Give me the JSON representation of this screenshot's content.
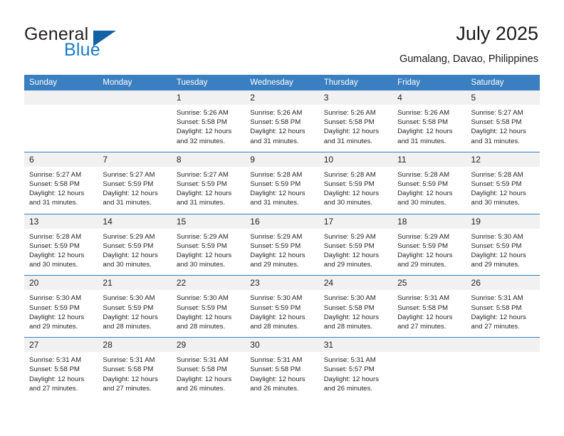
{
  "brand": {
    "name_part1": "General",
    "name_part2": "Blue",
    "triangle_icon": "triangle-icon"
  },
  "header": {
    "title": "July 2025",
    "subtitle": "Gumalang, Davao, Philippines"
  },
  "calendar": {
    "weekday_headers": [
      "Sunday",
      "Monday",
      "Tuesday",
      "Wednesday",
      "Thursday",
      "Friday",
      "Saturday"
    ],
    "accent_color": "#3a7fc1",
    "daynum_bg": "#f1f1f1",
    "weeks": [
      [
        {
          "day": "",
          "lines": []
        },
        {
          "day": "",
          "lines": []
        },
        {
          "day": "1",
          "lines": [
            "Sunrise: 5:26 AM",
            "Sunset: 5:58 PM",
            "Daylight: 12 hours",
            "and 32 minutes."
          ]
        },
        {
          "day": "2",
          "lines": [
            "Sunrise: 5:26 AM",
            "Sunset: 5:58 PM",
            "Daylight: 12 hours",
            "and 31 minutes."
          ]
        },
        {
          "day": "3",
          "lines": [
            "Sunrise: 5:26 AM",
            "Sunset: 5:58 PM",
            "Daylight: 12 hours",
            "and 31 minutes."
          ]
        },
        {
          "day": "4",
          "lines": [
            "Sunrise: 5:26 AM",
            "Sunset: 5:58 PM",
            "Daylight: 12 hours",
            "and 31 minutes."
          ]
        },
        {
          "day": "5",
          "lines": [
            "Sunrise: 5:27 AM",
            "Sunset: 5:58 PM",
            "Daylight: 12 hours",
            "and 31 minutes."
          ]
        }
      ],
      [
        {
          "day": "6",
          "lines": [
            "Sunrise: 5:27 AM",
            "Sunset: 5:58 PM",
            "Daylight: 12 hours",
            "and 31 minutes."
          ]
        },
        {
          "day": "7",
          "lines": [
            "Sunrise: 5:27 AM",
            "Sunset: 5:59 PM",
            "Daylight: 12 hours",
            "and 31 minutes."
          ]
        },
        {
          "day": "8",
          "lines": [
            "Sunrise: 5:27 AM",
            "Sunset: 5:59 PM",
            "Daylight: 12 hours",
            "and 31 minutes."
          ]
        },
        {
          "day": "9",
          "lines": [
            "Sunrise: 5:28 AM",
            "Sunset: 5:59 PM",
            "Daylight: 12 hours",
            "and 31 minutes."
          ]
        },
        {
          "day": "10",
          "lines": [
            "Sunrise: 5:28 AM",
            "Sunset: 5:59 PM",
            "Daylight: 12 hours",
            "and 30 minutes."
          ]
        },
        {
          "day": "11",
          "lines": [
            "Sunrise: 5:28 AM",
            "Sunset: 5:59 PM",
            "Daylight: 12 hours",
            "and 30 minutes."
          ]
        },
        {
          "day": "12",
          "lines": [
            "Sunrise: 5:28 AM",
            "Sunset: 5:59 PM",
            "Daylight: 12 hours",
            "and 30 minutes."
          ]
        }
      ],
      [
        {
          "day": "13",
          "lines": [
            "Sunrise: 5:28 AM",
            "Sunset: 5:59 PM",
            "Daylight: 12 hours",
            "and 30 minutes."
          ]
        },
        {
          "day": "14",
          "lines": [
            "Sunrise: 5:29 AM",
            "Sunset: 5:59 PM",
            "Daylight: 12 hours",
            "and 30 minutes."
          ]
        },
        {
          "day": "15",
          "lines": [
            "Sunrise: 5:29 AM",
            "Sunset: 5:59 PM",
            "Daylight: 12 hours",
            "and 30 minutes."
          ]
        },
        {
          "day": "16",
          "lines": [
            "Sunrise: 5:29 AM",
            "Sunset: 5:59 PM",
            "Daylight: 12 hours",
            "and 29 minutes."
          ]
        },
        {
          "day": "17",
          "lines": [
            "Sunrise: 5:29 AM",
            "Sunset: 5:59 PM",
            "Daylight: 12 hours",
            "and 29 minutes."
          ]
        },
        {
          "day": "18",
          "lines": [
            "Sunrise: 5:29 AM",
            "Sunset: 5:59 PM",
            "Daylight: 12 hours",
            "and 29 minutes."
          ]
        },
        {
          "day": "19",
          "lines": [
            "Sunrise: 5:30 AM",
            "Sunset: 5:59 PM",
            "Daylight: 12 hours",
            "and 29 minutes."
          ]
        }
      ],
      [
        {
          "day": "20",
          "lines": [
            "Sunrise: 5:30 AM",
            "Sunset: 5:59 PM",
            "Daylight: 12 hours",
            "and 29 minutes."
          ]
        },
        {
          "day": "21",
          "lines": [
            "Sunrise: 5:30 AM",
            "Sunset: 5:59 PM",
            "Daylight: 12 hours",
            "and 28 minutes."
          ]
        },
        {
          "day": "22",
          "lines": [
            "Sunrise: 5:30 AM",
            "Sunset: 5:59 PM",
            "Daylight: 12 hours",
            "and 28 minutes."
          ]
        },
        {
          "day": "23",
          "lines": [
            "Sunrise: 5:30 AM",
            "Sunset: 5:59 PM",
            "Daylight: 12 hours",
            "and 28 minutes."
          ]
        },
        {
          "day": "24",
          "lines": [
            "Sunrise: 5:30 AM",
            "Sunset: 5:58 PM",
            "Daylight: 12 hours",
            "and 28 minutes."
          ]
        },
        {
          "day": "25",
          "lines": [
            "Sunrise: 5:31 AM",
            "Sunset: 5:58 PM",
            "Daylight: 12 hours",
            "and 27 minutes."
          ]
        },
        {
          "day": "26",
          "lines": [
            "Sunrise: 5:31 AM",
            "Sunset: 5:58 PM",
            "Daylight: 12 hours",
            "and 27 minutes."
          ]
        }
      ],
      [
        {
          "day": "27",
          "lines": [
            "Sunrise: 5:31 AM",
            "Sunset: 5:58 PM",
            "Daylight: 12 hours",
            "and 27 minutes."
          ]
        },
        {
          "day": "28",
          "lines": [
            "Sunrise: 5:31 AM",
            "Sunset: 5:58 PM",
            "Daylight: 12 hours",
            "and 27 minutes."
          ]
        },
        {
          "day": "29",
          "lines": [
            "Sunrise: 5:31 AM",
            "Sunset: 5:58 PM",
            "Daylight: 12 hours",
            "and 26 minutes."
          ]
        },
        {
          "day": "30",
          "lines": [
            "Sunrise: 5:31 AM",
            "Sunset: 5:58 PM",
            "Daylight: 12 hours",
            "and 26 minutes."
          ]
        },
        {
          "day": "31",
          "lines": [
            "Sunrise: 5:31 AM",
            "Sunset: 5:57 PM",
            "Daylight: 12 hours",
            "and 26 minutes."
          ]
        },
        {
          "day": "",
          "lines": []
        },
        {
          "day": "",
          "lines": []
        }
      ]
    ]
  }
}
